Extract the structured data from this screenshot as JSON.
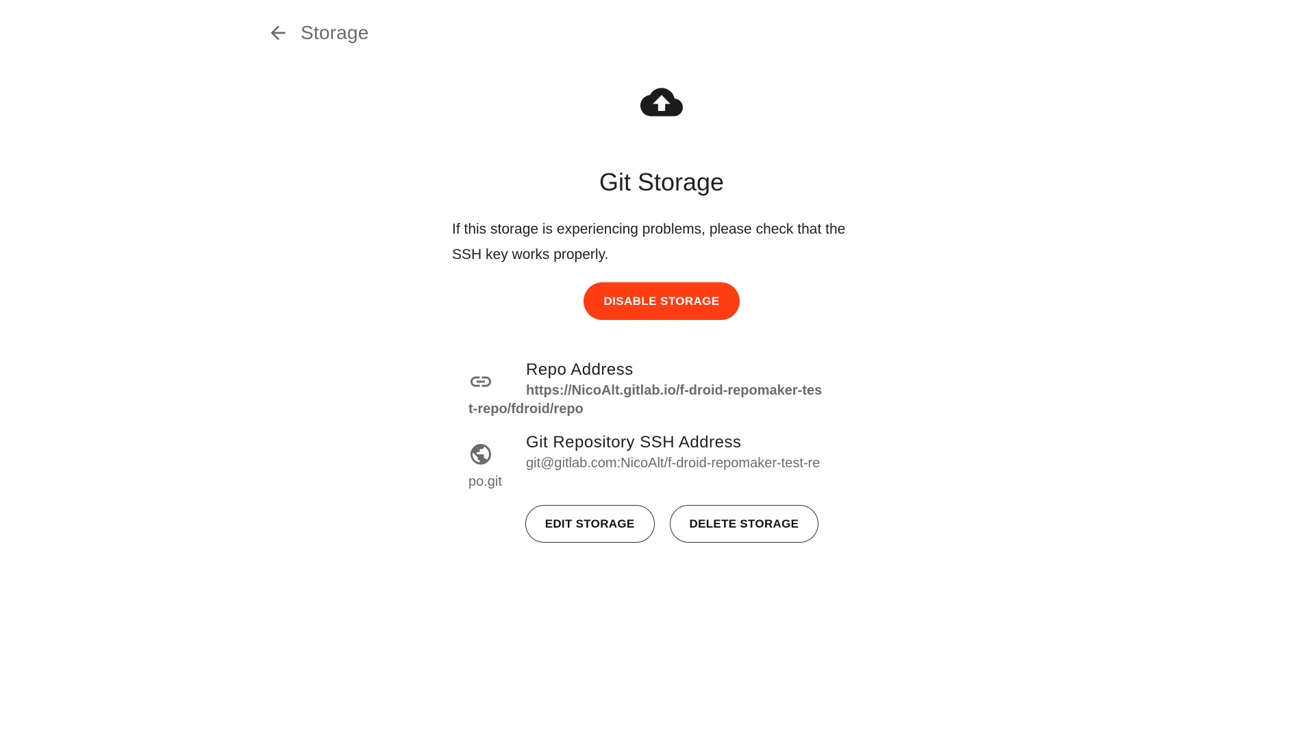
{
  "header": {
    "back_icon": "arrow-back-icon",
    "title": "Storage"
  },
  "storage": {
    "hero_icon": "cloud-upload-icon",
    "title": "Git Storage",
    "description": "If this storage is experiencing problems, please check that the SSH key works properly.",
    "disable_label": "DISABLE STORAGE",
    "accent_color": "#ff3d12"
  },
  "info": [
    {
      "icon": "link-icon",
      "label": "Repo Address",
      "value": "https://NicoAlt.gitlab.io/f-droid-repomaker-test-repo/fdroid/repo"
    },
    {
      "icon": "globe-icon",
      "label": "Git Repository SSH Address",
      "value": "git@gitlab.com:NicoAlt/f-droid-repomaker-test-repo.git"
    }
  ],
  "actions": {
    "edit_label": "EDIT STORAGE",
    "delete_label": "DELETE STORAGE"
  }
}
